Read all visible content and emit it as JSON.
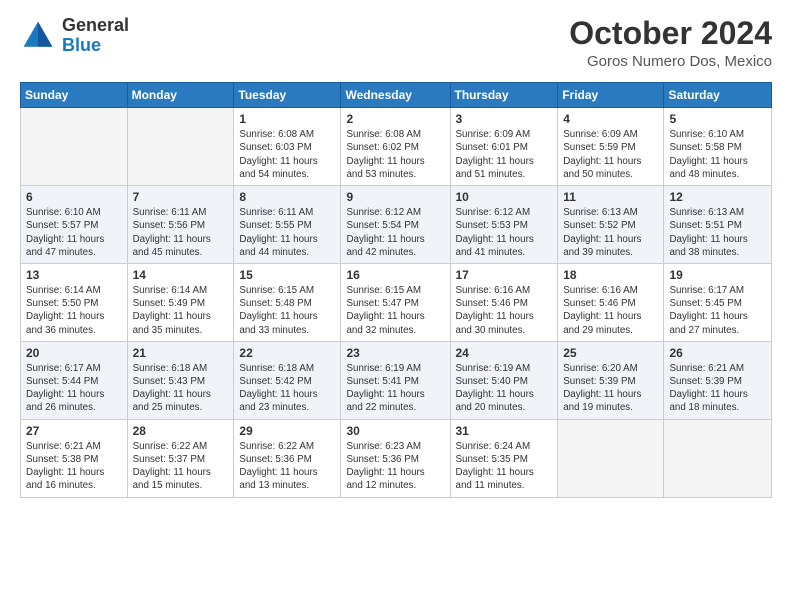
{
  "header": {
    "logo_general": "General",
    "logo_blue": "Blue",
    "month_title": "October 2024",
    "location": "Goros Numero Dos, Mexico"
  },
  "weekdays": [
    "Sunday",
    "Monday",
    "Tuesday",
    "Wednesday",
    "Thursday",
    "Friday",
    "Saturday"
  ],
  "weeks": [
    [
      {
        "day": "",
        "empty": true
      },
      {
        "day": "",
        "empty": true
      },
      {
        "day": "1",
        "sunrise": "6:08 AM",
        "sunset": "6:03 PM",
        "daylight": "11 hours and 54 minutes."
      },
      {
        "day": "2",
        "sunrise": "6:08 AM",
        "sunset": "6:02 PM",
        "daylight": "11 hours and 53 minutes."
      },
      {
        "day": "3",
        "sunrise": "6:09 AM",
        "sunset": "6:01 PM",
        "daylight": "11 hours and 51 minutes."
      },
      {
        "day": "4",
        "sunrise": "6:09 AM",
        "sunset": "5:59 PM",
        "daylight": "11 hours and 50 minutes."
      },
      {
        "day": "5",
        "sunrise": "6:10 AM",
        "sunset": "5:58 PM",
        "daylight": "11 hours and 48 minutes."
      }
    ],
    [
      {
        "day": "6",
        "sunrise": "6:10 AM",
        "sunset": "5:57 PM",
        "daylight": "11 hours and 47 minutes."
      },
      {
        "day": "7",
        "sunrise": "6:11 AM",
        "sunset": "5:56 PM",
        "daylight": "11 hours and 45 minutes."
      },
      {
        "day": "8",
        "sunrise": "6:11 AM",
        "sunset": "5:55 PM",
        "daylight": "11 hours and 44 minutes."
      },
      {
        "day": "9",
        "sunrise": "6:12 AM",
        "sunset": "5:54 PM",
        "daylight": "11 hours and 42 minutes."
      },
      {
        "day": "10",
        "sunrise": "6:12 AM",
        "sunset": "5:53 PM",
        "daylight": "11 hours and 41 minutes."
      },
      {
        "day": "11",
        "sunrise": "6:13 AM",
        "sunset": "5:52 PM",
        "daylight": "11 hours and 39 minutes."
      },
      {
        "day": "12",
        "sunrise": "6:13 AM",
        "sunset": "5:51 PM",
        "daylight": "11 hours and 38 minutes."
      }
    ],
    [
      {
        "day": "13",
        "sunrise": "6:14 AM",
        "sunset": "5:50 PM",
        "daylight": "11 hours and 36 minutes."
      },
      {
        "day": "14",
        "sunrise": "6:14 AM",
        "sunset": "5:49 PM",
        "daylight": "11 hours and 35 minutes."
      },
      {
        "day": "15",
        "sunrise": "6:15 AM",
        "sunset": "5:48 PM",
        "daylight": "11 hours and 33 minutes."
      },
      {
        "day": "16",
        "sunrise": "6:15 AM",
        "sunset": "5:47 PM",
        "daylight": "11 hours and 32 minutes."
      },
      {
        "day": "17",
        "sunrise": "6:16 AM",
        "sunset": "5:46 PM",
        "daylight": "11 hours and 30 minutes."
      },
      {
        "day": "18",
        "sunrise": "6:16 AM",
        "sunset": "5:46 PM",
        "daylight": "11 hours and 29 minutes."
      },
      {
        "day": "19",
        "sunrise": "6:17 AM",
        "sunset": "5:45 PM",
        "daylight": "11 hours and 27 minutes."
      }
    ],
    [
      {
        "day": "20",
        "sunrise": "6:17 AM",
        "sunset": "5:44 PM",
        "daylight": "11 hours and 26 minutes."
      },
      {
        "day": "21",
        "sunrise": "6:18 AM",
        "sunset": "5:43 PM",
        "daylight": "11 hours and 25 minutes."
      },
      {
        "day": "22",
        "sunrise": "6:18 AM",
        "sunset": "5:42 PM",
        "daylight": "11 hours and 23 minutes."
      },
      {
        "day": "23",
        "sunrise": "6:19 AM",
        "sunset": "5:41 PM",
        "daylight": "11 hours and 22 minutes."
      },
      {
        "day": "24",
        "sunrise": "6:19 AM",
        "sunset": "5:40 PM",
        "daylight": "11 hours and 20 minutes."
      },
      {
        "day": "25",
        "sunrise": "6:20 AM",
        "sunset": "5:39 PM",
        "daylight": "11 hours and 19 minutes."
      },
      {
        "day": "26",
        "sunrise": "6:21 AM",
        "sunset": "5:39 PM",
        "daylight": "11 hours and 18 minutes."
      }
    ],
    [
      {
        "day": "27",
        "sunrise": "6:21 AM",
        "sunset": "5:38 PM",
        "daylight": "11 hours and 16 minutes."
      },
      {
        "day": "28",
        "sunrise": "6:22 AM",
        "sunset": "5:37 PM",
        "daylight": "11 hours and 15 minutes."
      },
      {
        "day": "29",
        "sunrise": "6:22 AM",
        "sunset": "5:36 PM",
        "daylight": "11 hours and 13 minutes."
      },
      {
        "day": "30",
        "sunrise": "6:23 AM",
        "sunset": "5:36 PM",
        "daylight": "11 hours and 12 minutes."
      },
      {
        "day": "31",
        "sunrise": "6:24 AM",
        "sunset": "5:35 PM",
        "daylight": "11 hours and 11 minutes."
      },
      {
        "day": "",
        "empty": true
      },
      {
        "day": "",
        "empty": true
      }
    ]
  ],
  "labels": {
    "sunrise": "Sunrise:",
    "sunset": "Sunset:",
    "daylight": "Daylight:"
  }
}
